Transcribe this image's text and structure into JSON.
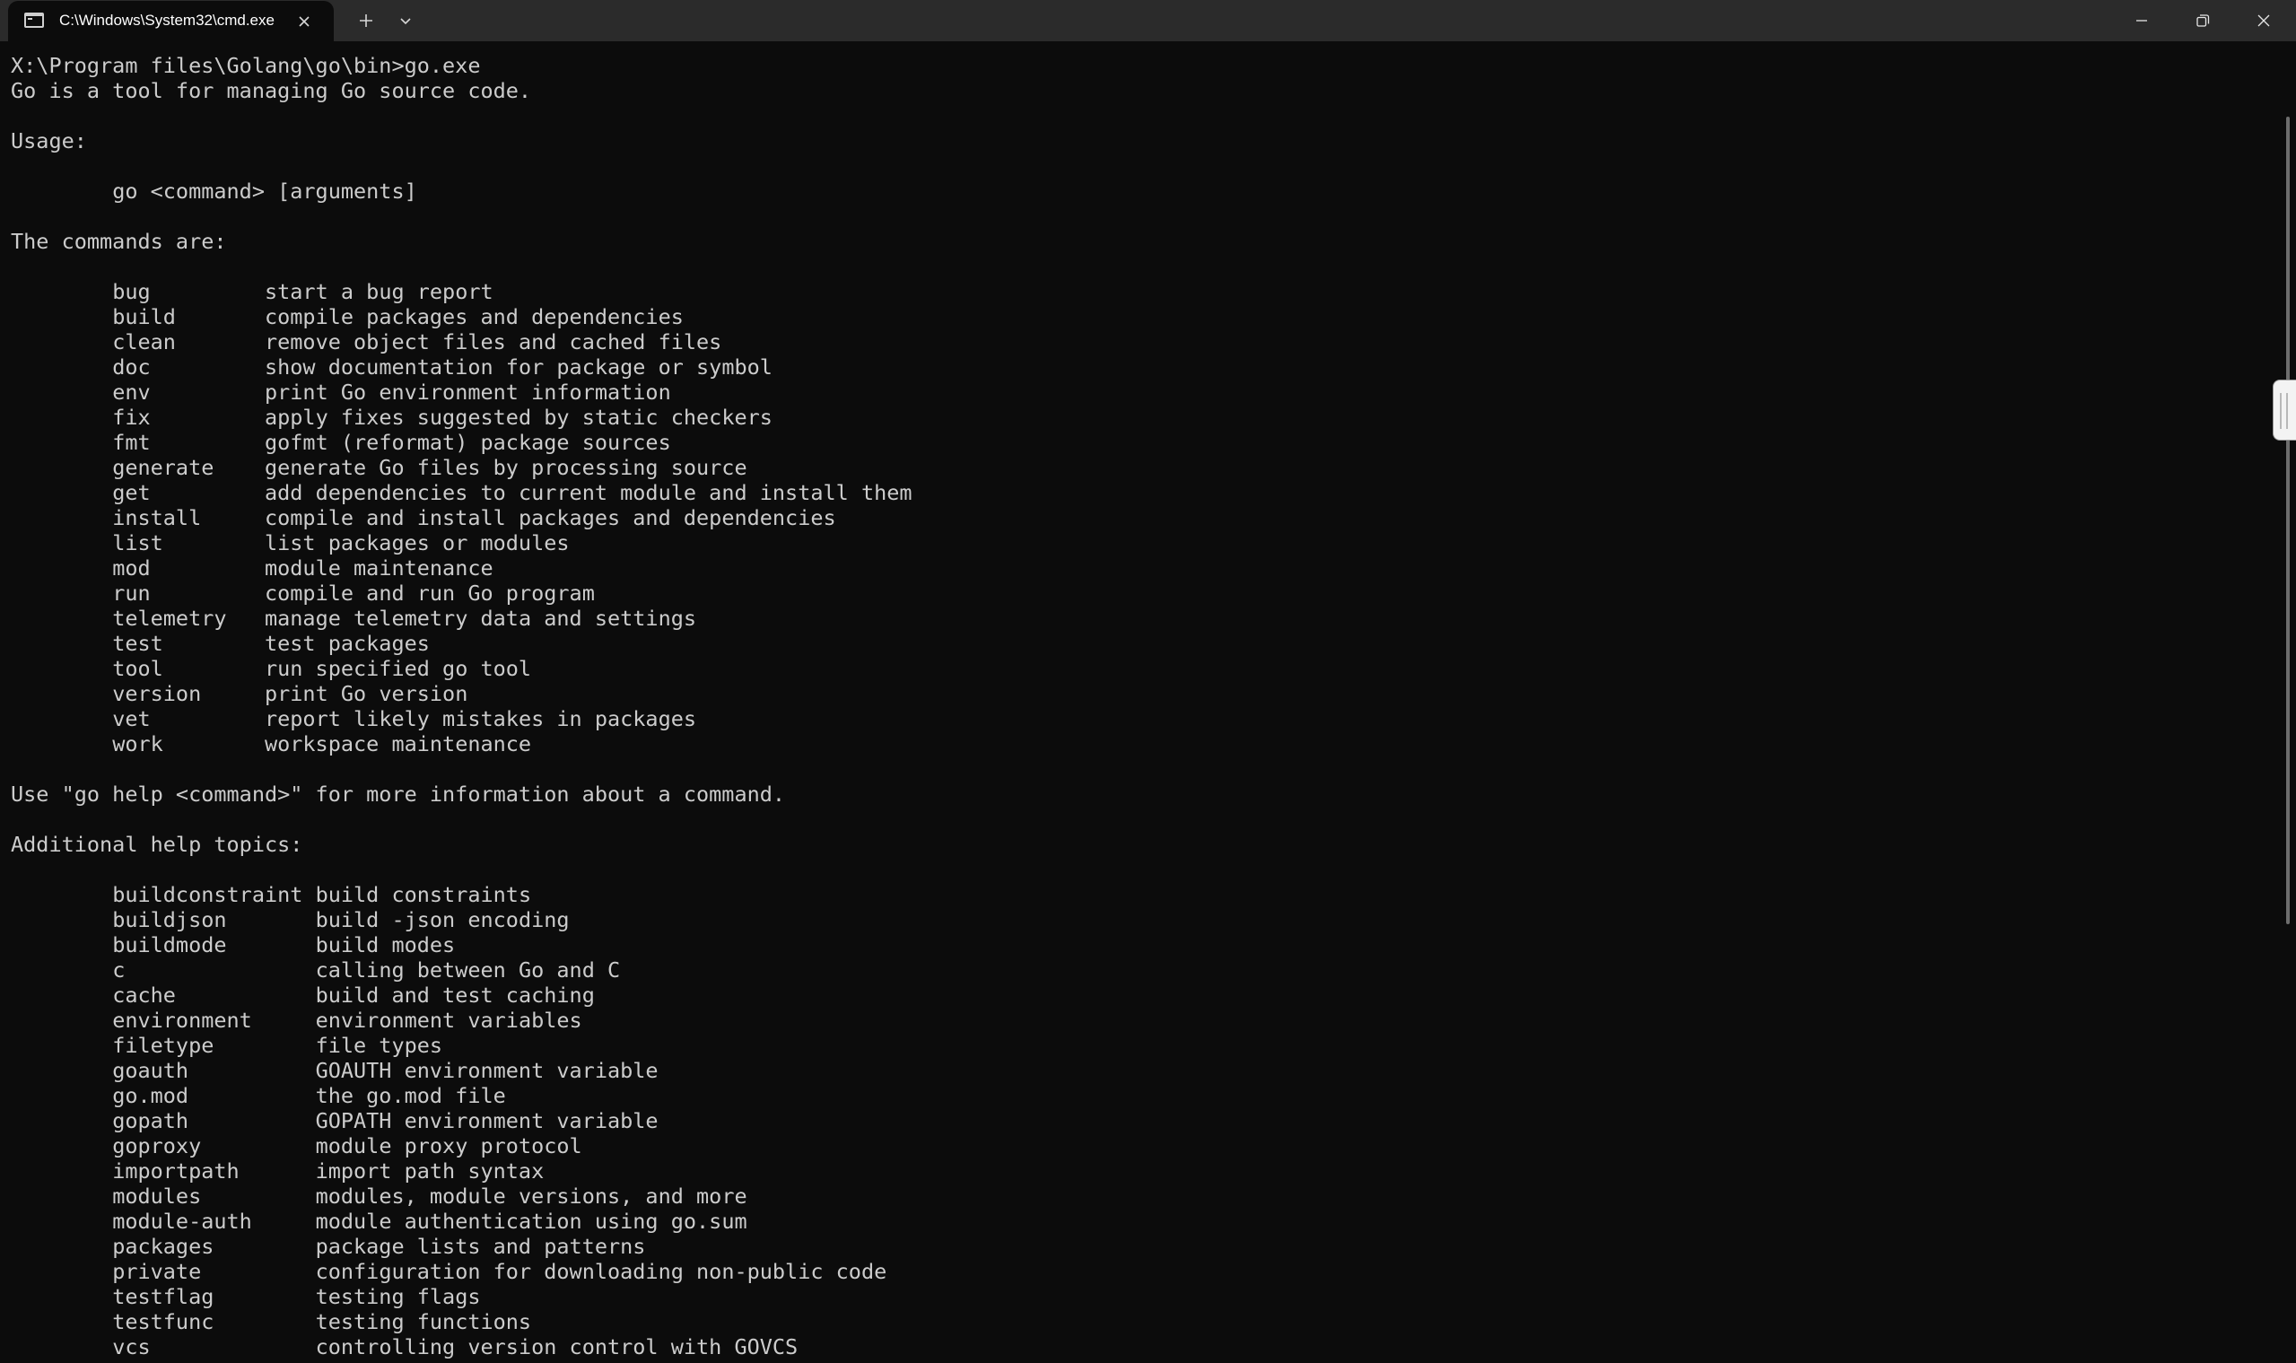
{
  "window": {
    "tab_title": "C:\\Windows\\System32\\cmd.exe",
    "icons": {
      "tab": "terminal-app-icon",
      "close_tab": "close-icon",
      "new_tab": "plus-icon",
      "dropdown": "chevron-down-icon",
      "minimize": "minimize-icon",
      "maximize": "restore-icon",
      "close_window": "close-icon"
    },
    "colors": {
      "titlebar_bg": "#2b2b2b",
      "tab_bg": "#0c0c0c",
      "terminal_bg": "#0c0c0c",
      "terminal_fg": "#cccccc"
    }
  },
  "terminal": {
    "prompt": "X:\\Program files\\Golang\\go\\bin>go.exe",
    "intro": "Go is a tool for managing Go source code.",
    "usage_heading": "Usage:",
    "usage_line": "go <command> [arguments]",
    "commands_heading": "The commands are:",
    "commands": [
      {
        "name": "bug",
        "desc": "start a bug report"
      },
      {
        "name": "build",
        "desc": "compile packages and dependencies"
      },
      {
        "name": "clean",
        "desc": "remove object files and cached files"
      },
      {
        "name": "doc",
        "desc": "show documentation for package or symbol"
      },
      {
        "name": "env",
        "desc": "print Go environment information"
      },
      {
        "name": "fix",
        "desc": "apply fixes suggested by static checkers"
      },
      {
        "name": "fmt",
        "desc": "gofmt (reformat) package sources"
      },
      {
        "name": "generate",
        "desc": "generate Go files by processing source"
      },
      {
        "name": "get",
        "desc": "add dependencies to current module and install them"
      },
      {
        "name": "install",
        "desc": "compile and install packages and dependencies"
      },
      {
        "name": "list",
        "desc": "list packages or modules"
      },
      {
        "name": "mod",
        "desc": "module maintenance"
      },
      {
        "name": "run",
        "desc": "compile and run Go program"
      },
      {
        "name": "telemetry",
        "desc": "manage telemetry data and settings"
      },
      {
        "name": "test",
        "desc": "test packages"
      },
      {
        "name": "tool",
        "desc": "run specified go tool"
      },
      {
        "name": "version",
        "desc": "print Go version"
      },
      {
        "name": "vet",
        "desc": "report likely mistakes in packages"
      },
      {
        "name": "work",
        "desc": "workspace maintenance"
      }
    ],
    "help_hint": "Use \"go help <command>\" for more information about a command.",
    "topics_heading": "Additional help topics:",
    "topics": [
      {
        "name": "buildconstraint",
        "desc": "build constraints"
      },
      {
        "name": "buildjson",
        "desc": "build -json encoding"
      },
      {
        "name": "buildmode",
        "desc": "build modes"
      },
      {
        "name": "c",
        "desc": "calling between Go and C"
      },
      {
        "name": "cache",
        "desc": "build and test caching"
      },
      {
        "name": "environment",
        "desc": "environment variables"
      },
      {
        "name": "filetype",
        "desc": "file types"
      },
      {
        "name": "goauth",
        "desc": "GOAUTH environment variable"
      },
      {
        "name": "go.mod",
        "desc": "the go.mod file"
      },
      {
        "name": "gopath",
        "desc": "GOPATH environment variable"
      },
      {
        "name": "goproxy",
        "desc": "module proxy protocol"
      },
      {
        "name": "importpath",
        "desc": "import path syntax"
      },
      {
        "name": "modules",
        "desc": "modules, module versions, and more"
      },
      {
        "name": "module-auth",
        "desc": "module authentication using go.sum"
      },
      {
        "name": "packages",
        "desc": "package lists and patterns"
      },
      {
        "name": "private",
        "desc": "configuration for downloading non-public code"
      },
      {
        "name": "testflag",
        "desc": "testing flags"
      },
      {
        "name": "testfunc",
        "desc": "testing functions"
      },
      {
        "name": "vcs",
        "desc": "controlling version control with GOVCS"
      }
    ]
  }
}
